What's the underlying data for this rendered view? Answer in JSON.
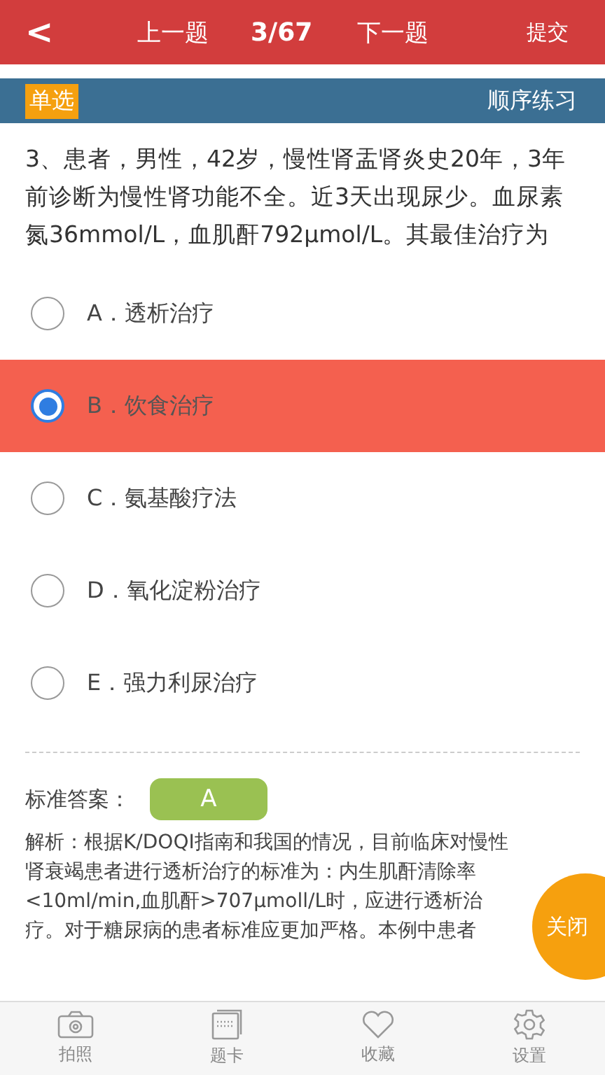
{
  "header": {
    "back": "<",
    "prev": "上一题",
    "progress": "3/67",
    "next": "下一题",
    "submit": "提交"
  },
  "subheader": {
    "type_badge": "单选",
    "mode": "顺序练习"
  },
  "question": "3、患者，男性，42岁，慢性肾盂肾炎史20年，3年前诊断为慢性肾功能不全。近3天出现尿少。血尿素氮36mmol/L，血肌酐792μmol/L。其最佳治疗为",
  "options": [
    {
      "label": "A．透析治疗",
      "selected": false
    },
    {
      "label": "B．饮食治疗",
      "selected": true
    },
    {
      "label": "C．氨基酸疗法",
      "selected": false
    },
    {
      "label": "D．氧化淀粉治疗",
      "selected": false
    },
    {
      "label": "E．强力利尿治疗",
      "selected": false
    }
  ],
  "answer": {
    "label": "标准答案：",
    "value": "A"
  },
  "analysis": "解析：根据K/DOQI指南和我国的情况，目前临床对慢性肾衰竭患者进行透析治疗的标准为：内生肌酐清除率<10ml/min,血肌酐>707μmoll/L时，应进行透析治疗。对于糖尿病的患者标准应更加严格。本例中患者",
  "close_button": "关闭",
  "tabs": [
    {
      "kind": "camera",
      "label": "拍照"
    },
    {
      "kind": "card",
      "label": "题卡"
    },
    {
      "kind": "heart",
      "label": "收藏"
    },
    {
      "kind": "gear",
      "label": "设置"
    }
  ]
}
